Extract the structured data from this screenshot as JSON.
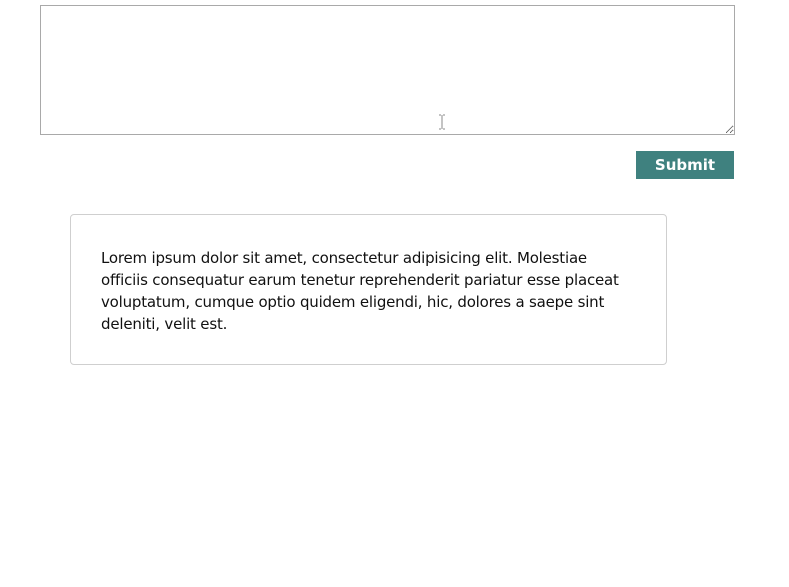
{
  "form": {
    "textarea_value": "",
    "submit_label": "Submit"
  },
  "card": {
    "text": "Lorem ipsum dolor sit amet, consectetur adipisicing elit. Molestiae officiis consequatur earum tenetur reprehenderit pariatur esse placeat voluptatum, cumque optio quidem eligendi, hic, dolores a saepe sint deleniti, velit est."
  },
  "colors": {
    "button_bg": "#3f817f",
    "button_text": "#ffffff",
    "card_border": "#cfcfcf",
    "textarea_border": "#a9a9a9"
  },
  "icons": {
    "cursor": "text-cursor-icon"
  }
}
